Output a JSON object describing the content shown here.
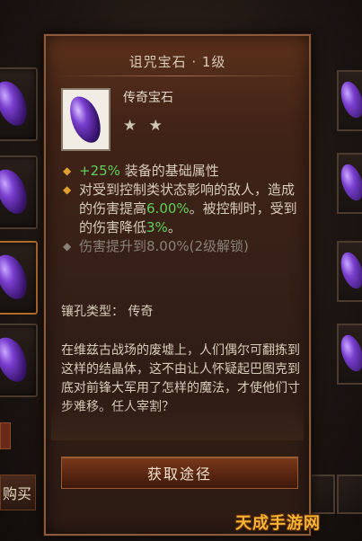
{
  "tooltip": {
    "title": "诅咒宝石 · 1级",
    "gem_type": "传奇宝石",
    "stars": "★ ★",
    "properties": [
      {
        "prefix": "+25%",
        "text": " 装备的基础属性",
        "locked": false
      },
      {
        "text_a": "对受到控制类状态影响的敌人，造成的伤害提高",
        "highlight_a": "6.00%",
        "text_b": "。被控制时，受到的伤害降低",
        "highlight_b": "3%",
        "text_c": "。",
        "locked": false
      },
      {
        "text": "伤害提升到8.00%(2级解锁)",
        "locked": true
      }
    ],
    "socket_label": "镶孔类型：  传奇",
    "lore": "在维兹古战场的废墟上，人们偶尔可翻拣到这样的结晶体，这不由让人怀疑起巴图克到底对前锋大军用了怎样的魔法，才使他们寸步难移。任人宰割？",
    "obtain_button": "获取途径"
  },
  "buy_button": "购买",
  "watermark": "天成手游网",
  "colors": {
    "accent_gold": "#e0a030",
    "highlight_green": "#5fd05a",
    "text": "#d8ccba"
  },
  "icons": [
    "gem-icon",
    "diamond-bullet-icon",
    "star-icon"
  ]
}
